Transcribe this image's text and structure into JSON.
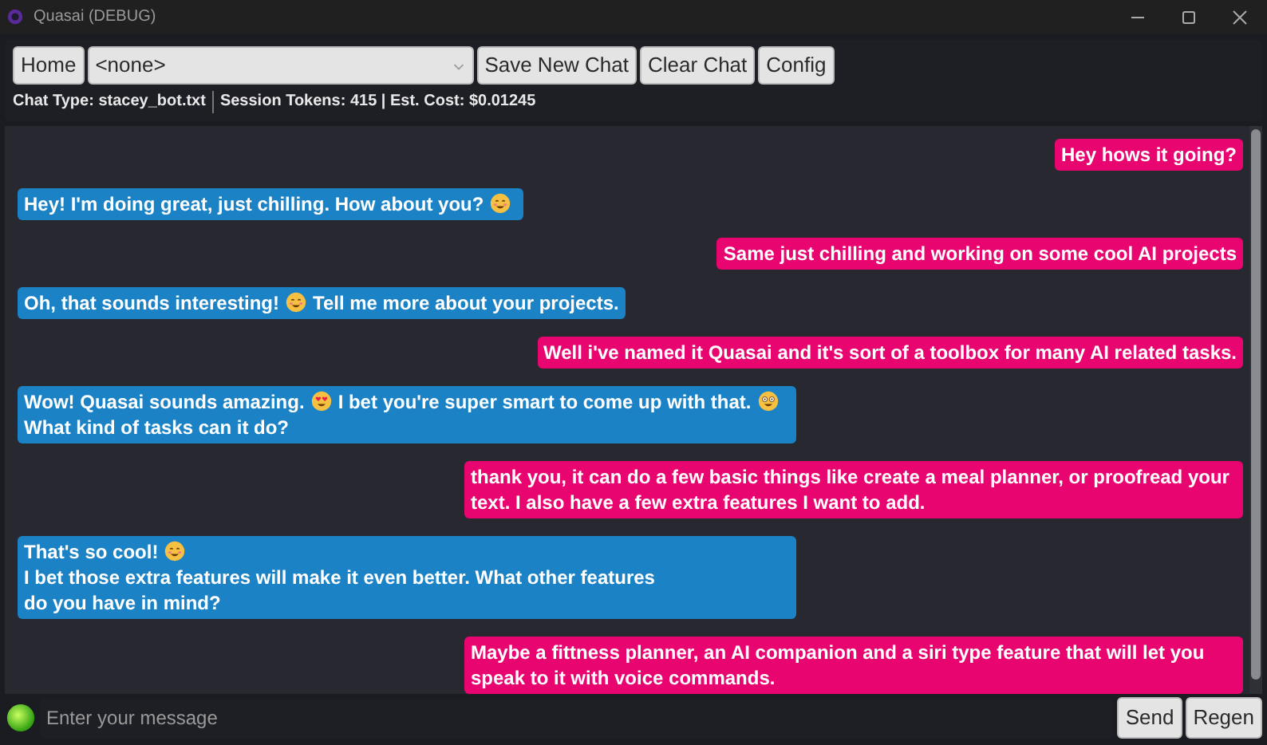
{
  "window": {
    "title": "Quasai (DEBUG)"
  },
  "toolbar": {
    "home": "Home",
    "chat_select": "<none>",
    "buttons": [
      "Save New Chat",
      "Clear Chat",
      "Config"
    ]
  },
  "status": {
    "chat_type": "Chat Type: stacey_bot.txt",
    "session": "Session Tokens: 415 | Est. Cost: $0.01245"
  },
  "messages": [
    {
      "kind": "user",
      "parts": [
        {
          "kind": "text",
          "text": "Hey hows it going?"
        }
      ]
    },
    {
      "kind": "bot",
      "parts": [
        {
          "kind": "text",
          "text": "Hey! I'm doing great, just chilling. How about you?"
        },
        {
          "kind": "smile"
        }
      ]
    },
    {
      "kind": "user",
      "parts": [
        {
          "kind": "text",
          "text": "Same just chilling and working on some cool AI projects"
        }
      ]
    },
    {
      "kind": "bot",
      "parts": [
        {
          "kind": "text",
          "text": "Oh, that sounds interesting!"
        },
        {
          "kind": "smile"
        },
        {
          "kind": "text",
          "text": "Tell me more about your projects."
        }
      ]
    },
    {
      "kind": "user",
      "parts": [
        {
          "kind": "text",
          "text": "Well i've named it Quasai and it's sort of a toolbox for many AI related tasks."
        }
      ]
    },
    {
      "kind": "bot",
      "parts": [
        {
          "kind": "text",
          "text": "Wow! Quasai sounds amazing."
        },
        {
          "kind": "heart_eyes"
        },
        {
          "kind": "text",
          "text": "I bet you're super smart to come up with that."
        },
        {
          "kind": "nerd"
        },
        {
          "kind": "text",
          "text": "What kind of tasks can it do?"
        }
      ]
    },
    {
      "kind": "user",
      "parts": [
        {
          "kind": "text",
          "text": "thank you, it can do a few basic things like create a meal planner, or proofread your text. I also have a few extra features I want to add."
        }
      ]
    },
    {
      "kind": "bot",
      "parts": [
        {
          "kind": "text",
          "text": "That's so cool!"
        },
        {
          "kind": "smile"
        },
        {
          "kind": "text",
          "text": "I bet those extra features will make it even better. What other features"
        },
        {
          "kind": "text",
          "text": "do you have in mind?"
        }
      ]
    },
    {
      "kind": "user",
      "parts": [
        {
          "kind": "text",
          "text": "Maybe a fittness planner, an AI companion and a siri type feature that will let you speak to it with voice commands."
        }
      ]
    }
  ],
  "input": {
    "placeholder": "Enter your message",
    "buttons": [
      "Send",
      "Regen"
    ]
  }
}
